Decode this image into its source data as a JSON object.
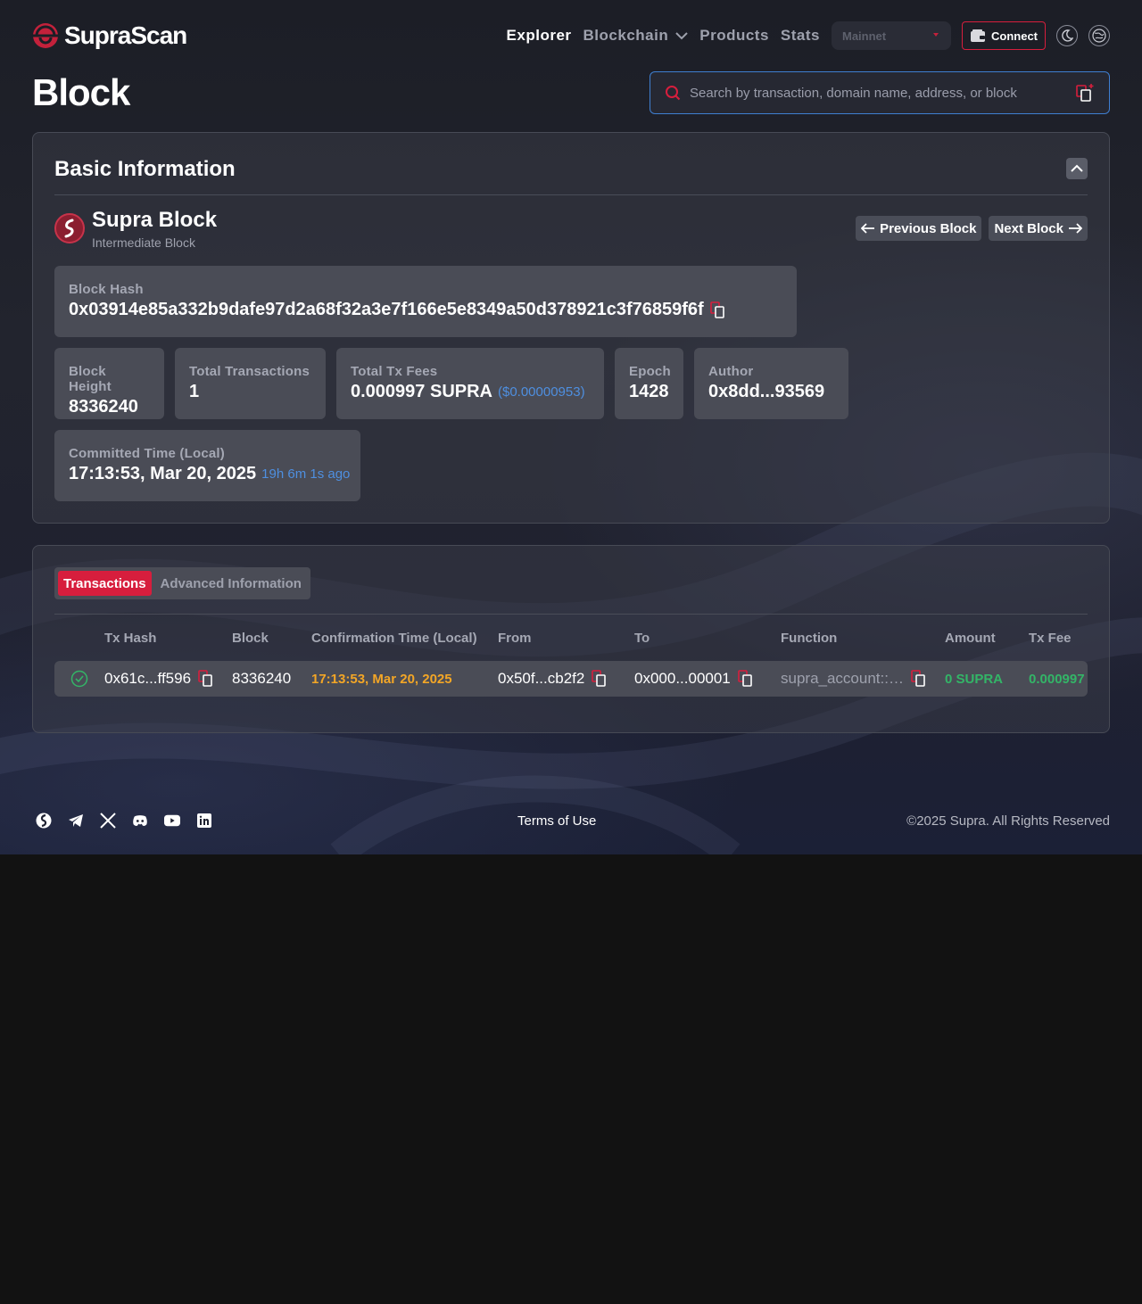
{
  "brand": {
    "name": "SupraScan"
  },
  "nav": {
    "items": [
      {
        "label": "Explorer",
        "active": true
      },
      {
        "label": "Blockchain",
        "active": false
      },
      {
        "label": "Products",
        "active": false
      },
      {
        "label": "Stats",
        "active": false
      }
    ],
    "network_selected": "Mainnet",
    "connect_label": "Connect"
  },
  "page": {
    "title": "Block"
  },
  "search": {
    "placeholder": "Search by transaction, domain name, address, or block"
  },
  "basic": {
    "title": "Basic Information",
    "block_name": "Supra Block",
    "block_type": "Intermediate Block",
    "prev_label": "Previous Block",
    "next_label": "Next Block",
    "fields": {
      "hash": {
        "label": "Block Hash",
        "value": "0x03914e85a332b9dafe97d2a68f32a3e7f166e5e8349a50d378921c3f76859f6f"
      },
      "height": {
        "label": "Block Height",
        "value": "8336240"
      },
      "total_tx": {
        "label": "Total Transactions",
        "value": "1"
      },
      "fees": {
        "label": "Total Tx Fees",
        "value": "0.000997 SUPRA",
        "usd": "($0.00000953)"
      },
      "epoch": {
        "label": "Epoch",
        "value": "1428"
      },
      "author": {
        "label": "Author",
        "value": "0x8dd...93569"
      },
      "committed": {
        "label": "Committed Time (Local)",
        "value": "17:13:53, Mar 20, 2025",
        "ago": "19h 6m 1s ago"
      }
    }
  },
  "tabs": [
    {
      "label": "Transactions",
      "active": true
    },
    {
      "label": "Advanced Information",
      "active": false
    }
  ],
  "table": {
    "columns": [
      "Tx Hash",
      "Block",
      "Confirmation Time (Local)",
      "From",
      "To",
      "Function",
      "Amount",
      "Tx Fee"
    ],
    "rows": [
      {
        "status": "success",
        "tx_hash": "0x61c...ff596",
        "block": "8336240",
        "time": "17:13:53, Mar 20, 2025",
        "from": "0x50f...cb2f2",
        "to": "0x000...00001",
        "function": "supra_account::…",
        "amount": "0 SUPRA",
        "fee": "0.000997"
      }
    ]
  },
  "footer": {
    "terms": "Terms of Use",
    "copyright": "©2025 Supra. All Rights Reserved",
    "social_icons": [
      "supra-icon",
      "telegram-icon",
      "x-icon",
      "discord-icon",
      "youtube-icon",
      "linkedin-icon"
    ]
  },
  "colors": {
    "accent": "#d71e3d",
    "link": "#4e8fe0",
    "time": "#f3a626",
    "success": "#33b567"
  }
}
